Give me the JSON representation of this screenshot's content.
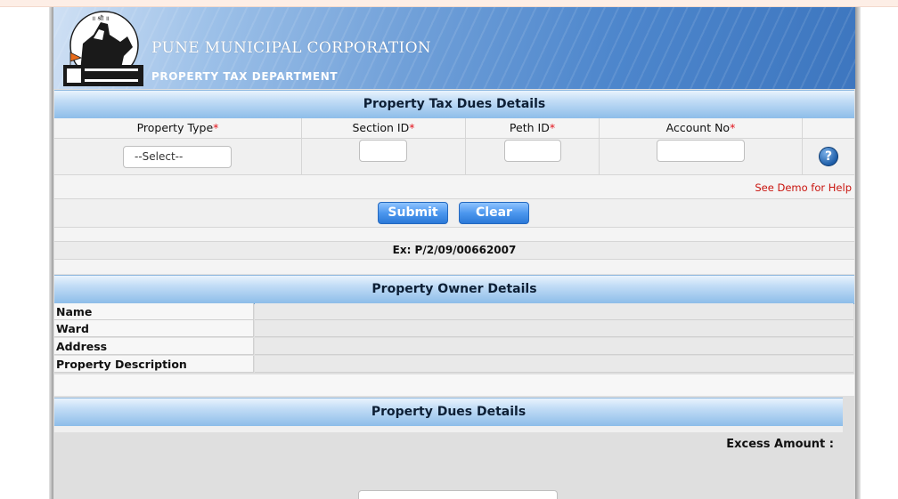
{
  "header": {
    "title": "PUNE MUNICIPAL CORPORATION",
    "subtitle": "PROPERTY TAX DEPARTMENT"
  },
  "dues_form": {
    "title": "Property Tax Dues Details",
    "columns": {
      "property_type": "Property Type",
      "section_id": "Section ID",
      "peth_id": "Peth ID",
      "account_no": "Account No"
    },
    "required_mark": "*",
    "property_type_selected": "--Select--",
    "section_id_value": "",
    "peth_id_value": "",
    "account_no_value": "",
    "demo_link": "See Demo for Help",
    "submit_label": "Submit",
    "clear_label": "Clear",
    "example": "Ex: P/2/09/00662007"
  },
  "owner": {
    "title": "Property Owner Details",
    "rows": [
      {
        "label": "Name",
        "value": ""
      },
      {
        "label": "Ward",
        "value": ""
      },
      {
        "label": "Address",
        "value": ""
      },
      {
        "label": "Property Description",
        "value": ""
      }
    ]
  },
  "property_dues": {
    "title": "Property Dues Details",
    "excess_label": "Excess Amount :"
  },
  "icons": {
    "help": "help-question-icon",
    "logo": "pmc-emblem-logo"
  },
  "colors": {
    "header_blue": "#4d86cc",
    "bar_blue": "#8dbde9",
    "button_blue": "#2b79d8",
    "required_red": "#e2121b",
    "demo_link_red": "#c9140e"
  }
}
